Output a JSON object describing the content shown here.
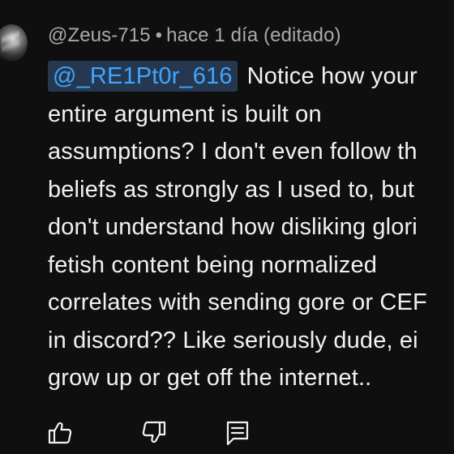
{
  "comment": {
    "author": "@Zeus-715",
    "separator": "•",
    "time": "hace 1 día (editado)",
    "mention": "@_RE1Pt0r_616",
    "lines": [
      "Notice how your",
      "entire argument is built on",
      "assumptions? I don't even follow th",
      "beliefs as strongly as I used to, but",
      "don't understand how disliking glori",
      "fetish content being normalized",
      "correlates with sending gore or CEF",
      "in discord??  Like seriously dude, ei",
      "grow up or get off the internet.."
    ]
  },
  "actions": {
    "like_icon": "thumb-up-outline",
    "dislike_icon": "thumb-down-outline",
    "reply_icon": "comment-reply-outline"
  },
  "colors": {
    "background": "#0f0f0f",
    "text": "#f1f1f1",
    "meta": "#aaaaaa",
    "mention_text": "#3ea6ff",
    "mention_bg": "#263850"
  }
}
